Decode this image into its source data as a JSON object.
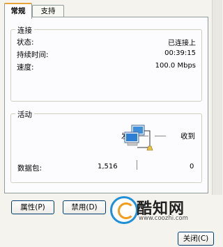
{
  "tabs": [
    {
      "label": "常规"
    },
    {
      "label": "支持"
    }
  ],
  "connection": {
    "title": "连接",
    "rows": [
      {
        "label": "状态:",
        "value": "已连接上"
      },
      {
        "label": "持续时间:",
        "value": "00:39:15"
      },
      {
        "label": "速度:",
        "value": "100.0 Mbps"
      }
    ]
  },
  "activity": {
    "title": "活动",
    "sent_label": "发送",
    "received_label": "收到",
    "packets_label": "数据包:",
    "packets_sent": "1,516",
    "packets_received": "0"
  },
  "buttons": {
    "properties": "属性(P)",
    "disable": "禁用(D)",
    "close": "关闭(C)"
  },
  "watermark": {
    "brand": "酷知网",
    "url": "www.coozhi.com"
  },
  "icons": {
    "network": "network-computers-icon",
    "logo": "coozhi-logo-icon"
  }
}
